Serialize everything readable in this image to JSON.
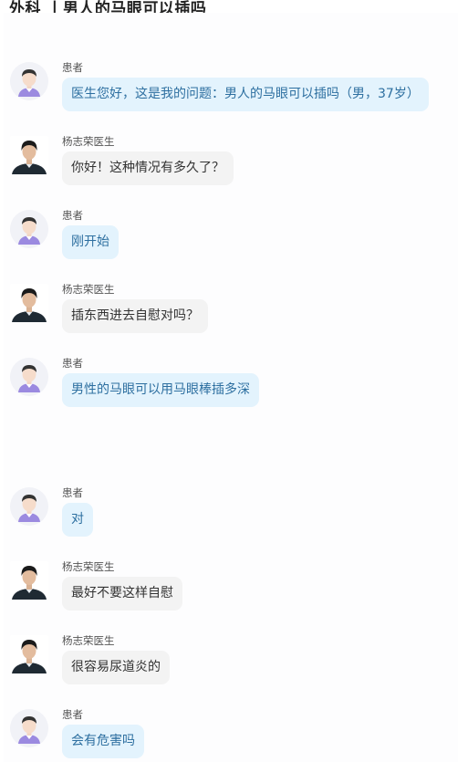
{
  "page_title": "外科 丨男人的马眼可以插吗",
  "messages": [
    {
      "role": "patient",
      "name": "患者",
      "text": "医生您好，这是我的问题：男人的马眼可以插吗（男，37岁）"
    },
    {
      "role": "doctor",
      "name": "杨志荣医生",
      "text": "你好！这种情况有多久了？"
    },
    {
      "role": "patient",
      "name": "患者",
      "text": "刚开始"
    },
    {
      "role": "doctor",
      "name": "杨志荣医生",
      "text": "插东西进去自慰对吗？"
    },
    {
      "role": "patient",
      "name": "患者",
      "text": "男性的马眼可以用马眼棒插多深"
    },
    {
      "role": "patient",
      "name": "患者",
      "text": "对"
    },
    {
      "role": "doctor",
      "name": "杨志荣医生",
      "text": "最好不要这样自慰"
    },
    {
      "role": "doctor",
      "name": "杨志荣医生",
      "text": "很容易尿道炎的"
    },
    {
      "role": "patient",
      "name": "患者",
      "text": "会有危害吗"
    }
  ],
  "colors": {
    "patient_bubble": "#e3f3fd",
    "patient_text": "#2d6fa0",
    "doctor_bubble": "#f3f3f3",
    "doctor_text": "#333333"
  },
  "icons": {
    "patient_avatar": "patient-avatar-icon",
    "doctor_avatar": "doctor-avatar-photo"
  }
}
